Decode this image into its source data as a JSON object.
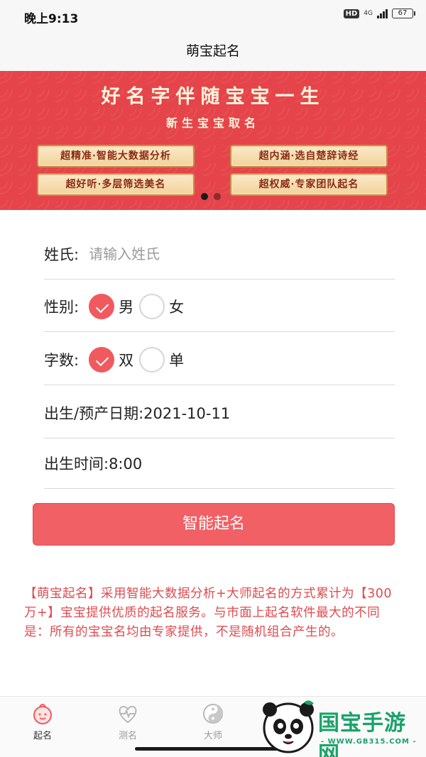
{
  "status_bar": {
    "time": "晚上9:13",
    "hd": "HD",
    "network": "4G",
    "battery": "67"
  },
  "header": {
    "title": "萌宝起名"
  },
  "banner": {
    "headline": "好名字伴随宝宝一生",
    "subtitle": "新生宝宝取名",
    "tags": [
      "超精准·智能大数据分析",
      "超内涵·选自楚辞诗经",
      "超好听·多层筛选美名",
      "超权威·专家团队起名"
    ],
    "page_count": 2,
    "active_page": 1
  },
  "form": {
    "surname": {
      "label": "姓氏:",
      "placeholder": "请输入姓氏",
      "value": ""
    },
    "gender": {
      "label": "性别:",
      "options": [
        "男",
        "女"
      ],
      "selected": "男"
    },
    "char_count": {
      "label": "字数:",
      "options": [
        "双",
        "单"
      ],
      "selected": "双"
    },
    "birth_date": {
      "text": "出生/预产日期:2021-10-11"
    },
    "birth_time": {
      "text": "出生时间:8:00"
    }
  },
  "submit_label": "智能起名",
  "intro_text": "【萌宝起名】采用智能大数据分析+大师起名的方式累计为【300万+】宝宝提供优质的起名服务。与市面上起名软件最大的不同是：所有的宝宝名均由专家提供，不是随机组合产生的。",
  "bottom_nav": [
    {
      "label": "起名",
      "icon": "baby-face-icon",
      "active": true
    },
    {
      "label": "测名",
      "icon": "heart-pulse-icon",
      "active": false
    },
    {
      "label": "大师",
      "icon": "yin-yang-icon",
      "active": false
    }
  ],
  "watermark": {
    "logo_text": "国宝手游网",
    "url": "- WWW.GB315.COM -"
  },
  "colors": {
    "accent": "#f05a5f",
    "banner_red": "#e5454a",
    "watermark_green": "#1aa36a"
  }
}
